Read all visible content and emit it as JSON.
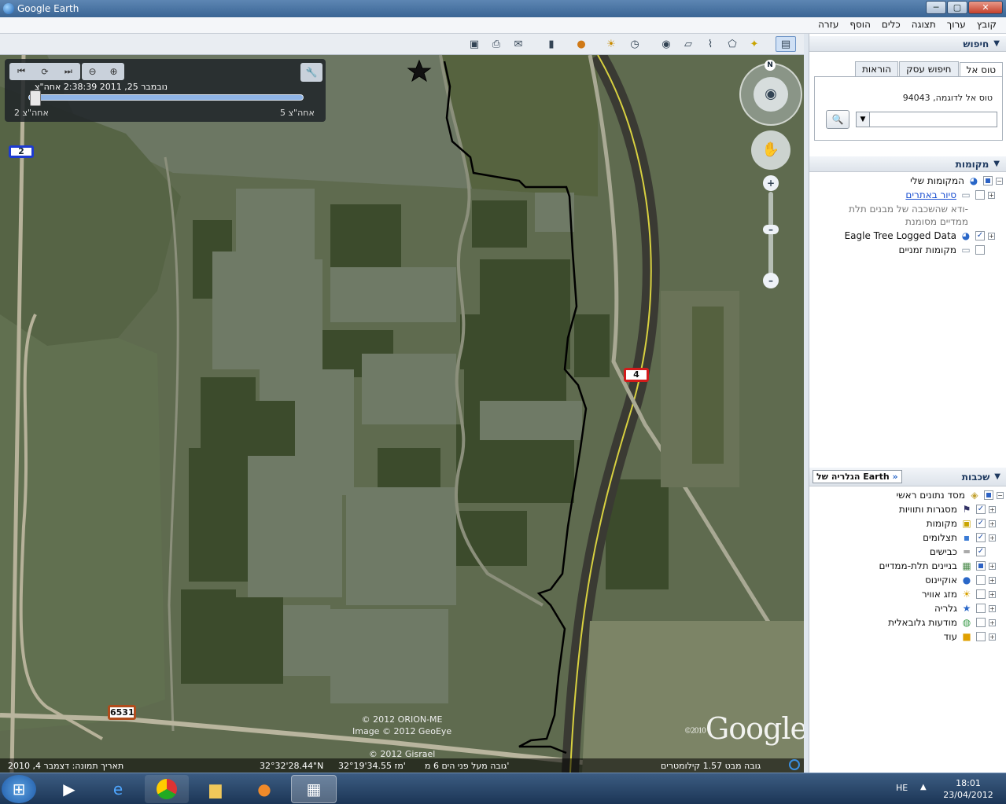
{
  "window": {
    "title": "Google Earth",
    "controls": [
      "─",
      "▢",
      "✕"
    ]
  },
  "menu": [
    "קובץ",
    "ערוך",
    "תצוגה",
    "כלים",
    "הוסף",
    "עזרה"
  ],
  "time_slider": {
    "date_label": "נובמבר 25, 2011  2:38:39 אחה\"צ",
    "start_label": "2 אחה\"צ",
    "end_label": "5 אחה\"צ"
  },
  "map": {
    "road_shields": [
      "2",
      "4",
      "6531"
    ],
    "compass_n": "N",
    "attribution": [
      "© 2012 ORION-ME",
      "Image © 2012 GeoEye",
      "© 2012 Gisrael"
    ],
    "logo": "Google",
    "logo_year": "©2010"
  },
  "status": {
    "imagery_date": "תאריך תמונה: דצמבר 4, 2010",
    "lat": "32°32'28.44\"N",
    "lon": "32°19'34.55 מז'",
    "elevation": "גובה מעל פני הים  6 מ'",
    "eye_alt": "גובה מבט  1.57 קילומטרים"
  },
  "search": {
    "header": "חיפוש",
    "tabs": [
      "טוס אל",
      "חיפוש עסק",
      "הוראות"
    ],
    "hint": "טוס אל לדוגמה, 94043",
    "value": ""
  },
  "places": {
    "header": "מקומות",
    "items": [
      {
        "label": "המקומות שלי",
        "checked": "partial"
      },
      {
        "label": "סיור באתרים",
        "checked": false,
        "link": true
      },
      {
        "label": "ודא שהשכבה של מבנים תלת-",
        "checked": null
      },
      {
        "label": "ממדיים מסומנת",
        "checked": null
      },
      {
        "label": "Eagle Tree Logged Data",
        "checked": true
      },
      {
        "label": "מקומות זמניים",
        "checked": false
      }
    ]
  },
  "layers": {
    "header": "שכבות",
    "gallery_button": "Earth הגלריה של",
    "items": [
      {
        "label": "מסד נתונים ראשי",
        "checked": "partial"
      },
      {
        "label": "מסגרות ותוויות",
        "checked": true
      },
      {
        "label": "מקומות",
        "checked": true
      },
      {
        "label": "תצלומים",
        "checked": true
      },
      {
        "label": "כבישים",
        "checked": true
      },
      {
        "label": "בניינים תלת-ממדיים",
        "checked": "partial"
      },
      {
        "label": "אוקיינוס",
        "checked": false
      },
      {
        "label": "מזג אוויר",
        "checked": false
      },
      {
        "label": "גלריה",
        "checked": false
      },
      {
        "label": "מודעות גלובאלית",
        "checked": false
      },
      {
        "label": "עוד",
        "checked": false
      }
    ]
  },
  "taskbar": {
    "lang": "HE",
    "time": "18:01",
    "date": "23/04/2012"
  }
}
